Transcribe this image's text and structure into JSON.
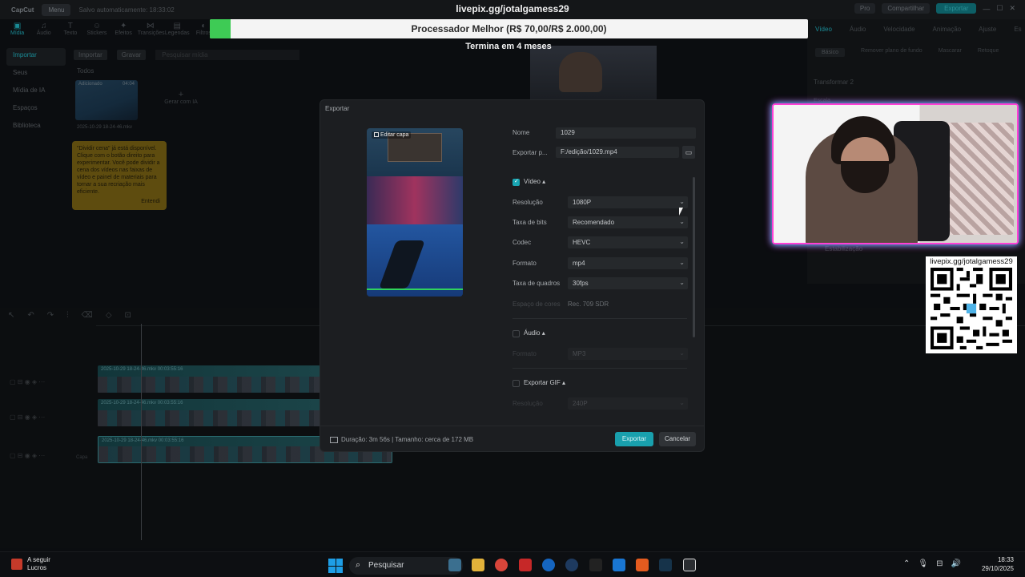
{
  "app": {
    "logo": "CapCut",
    "menu": "Menu",
    "autosave": "Salvo automaticamente: 18:33:02",
    "top_right": {
      "pro": "Pro",
      "share": "Compartilhar",
      "export": "Exportar"
    }
  },
  "tool_tabs": [
    "Mídia",
    "Áudio",
    "Texto",
    "Stickers",
    "Efeitos",
    "Transições",
    "Legendas",
    "Filtros"
  ],
  "left_sidebar": [
    "Importar",
    "Seus",
    "Mídia de IA",
    "Espaços",
    "Biblioteca"
  ],
  "media": {
    "import": "Importar",
    "record": "Gravar",
    "search_placeholder": "Pesquisar mídia",
    "filter_all": "Todos",
    "added": "Adicionado",
    "thumb_duration": "04:04",
    "thumb_name": "2025-10-29 18-24-46.mkv",
    "generate": "Gerar com IA"
  },
  "tooltip": {
    "text": "\"Dividir cena\" já está disponível. Clique com o botão direito para experimentar. Você pode dividir a cena dos vídeos nas faixas de vídeo e painel de materiais para tornar a sua recriação mais eficiente.",
    "ok": "Entendi"
  },
  "right_panel": {
    "tabs": [
      "Vídeo",
      "Áudio",
      "Velocidade",
      "Animação",
      "Ajuste",
      "Es"
    ],
    "subtabs": [
      "Básico",
      "Remover plano de fundo",
      "Mascarar",
      "Retoque"
    ],
    "transform": "Transformar 2",
    "stabilize": "Estabilização",
    "scale": "Escala"
  },
  "timeline": {
    "clip_name": "2025-10-29 18-24-46.mkv",
    "clip_duration": "00:03:55:16",
    "cover": "Capa"
  },
  "overlay": {
    "donate_link": "livepix.gg/jotalgamess29",
    "goal_text": "Processador Melhor (R$ 70,00/R$ 2.000,00)",
    "goal_progress": 0.035,
    "goal_end": "Termina em 4 meses",
    "qr_label": "livepix.gg/jotalgamess29"
  },
  "export_dialog": {
    "title": "Exportar",
    "edit_cover": "Editar capa",
    "name_label": "Nome",
    "name_value": "1029",
    "export_to_label": "Exportar p...",
    "export_to_value": "F:/edição/1029.mp4",
    "video_section": "Vídeo",
    "video_checked": true,
    "resolution_label": "Resolução",
    "resolution_value": "1080P",
    "bitrate_label": "Taxa de bits",
    "bitrate_value": "Recomendado",
    "codec_label": "Codec",
    "codec_value": "HEVC",
    "format_label": "Formato",
    "format_value": "mp4",
    "fps_label": "Taxa de quadros",
    "fps_value": "30fps",
    "color_space_label": "Espaço de cores",
    "color_space_value": "Rec. 709 SDR",
    "audio_section": "Áudio",
    "audio_checked": false,
    "audio_format_label": "Formato",
    "audio_format_value": "MP3",
    "gif_section": "Exportar GIF",
    "gif_checked": false,
    "gif_resolution_label": "Resolução",
    "gif_resolution_value": "240P",
    "footer_info": "Duração: 3m 56s | Tamanho: cerca de 172 MB",
    "export_button": "Exportar",
    "cancel_button": "Cancelar"
  },
  "taskbar": {
    "weather_title": "A seguir",
    "weather_sub": "Lucros",
    "search_placeholder": "Pesquisar",
    "time": "18:33",
    "date": "29/10/2025"
  },
  "colors": {
    "accent": "#19a6b3",
    "goal_fill": "#3ecb55",
    "neon_pink": "#ff3fd5",
    "neon_cyan": "#1ad0ff"
  }
}
